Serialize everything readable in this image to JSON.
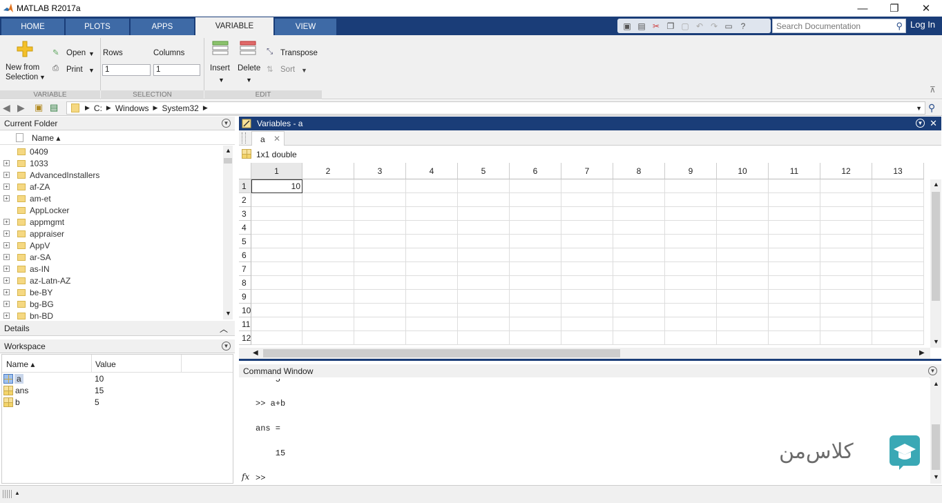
{
  "window": {
    "title": "MATLAB R2017a",
    "minimize": "—",
    "maximize": "❐",
    "close": "✕"
  },
  "tabs": [
    {
      "label": "HOME"
    },
    {
      "label": "PLOTS"
    },
    {
      "label": "APPS"
    },
    {
      "label": "VARIABLE"
    },
    {
      "label": "VIEW"
    }
  ],
  "search": {
    "placeholder": "Search Documentation"
  },
  "login": "Log In",
  "ribbon": {
    "new_from_selection_1": "New from",
    "new_from_selection_2": "Selection",
    "open": "Open",
    "print": "Print",
    "rows_label": "Rows",
    "columns_label": "Columns",
    "rows_value": "1",
    "columns_value": "1",
    "insert": "Insert",
    "delete": "Delete",
    "transpose": "Transpose",
    "sort": "Sort",
    "group_variable": "VARIABLE",
    "group_selection": "SELECTION",
    "group_edit": "EDIT"
  },
  "address": {
    "parts": [
      "C:",
      "Windows",
      "System32"
    ]
  },
  "current_folder": {
    "title": "Current Folder",
    "name_header": "Name ▴",
    "items": [
      {
        "name": "0409",
        "expandable": false
      },
      {
        "name": "1033",
        "expandable": true
      },
      {
        "name": "AdvancedInstallers",
        "expandable": true
      },
      {
        "name": "af-ZA",
        "expandable": true
      },
      {
        "name": "am-et",
        "expandable": true
      },
      {
        "name": "AppLocker",
        "expandable": false
      },
      {
        "name": "appmgmt",
        "expandable": true
      },
      {
        "name": "appraiser",
        "expandable": true
      },
      {
        "name": "AppV",
        "expandable": true
      },
      {
        "name": "ar-SA",
        "expandable": true
      },
      {
        "name": "as-IN",
        "expandable": true
      },
      {
        "name": "az-Latn-AZ",
        "expandable": true
      },
      {
        "name": "be-BY",
        "expandable": true
      },
      {
        "name": "bg-BG",
        "expandable": true
      },
      {
        "name": "bn-BD",
        "expandable": true
      }
    ]
  },
  "details": {
    "title": "Details"
  },
  "workspace": {
    "title": "Workspace",
    "col_name": "Name ▴",
    "col_value": "Value",
    "rows": [
      {
        "name": "a",
        "value": "10"
      },
      {
        "name": "ans",
        "value": "15"
      },
      {
        "name": "b",
        "value": "5"
      }
    ]
  },
  "variables": {
    "title": "Variables - a",
    "tab": "a",
    "info": "1x1 double",
    "columns": [
      "1",
      "2",
      "3",
      "4",
      "5",
      "6",
      "7",
      "8",
      "9",
      "10",
      "11",
      "12",
      "13"
    ],
    "rows": [
      "1",
      "2",
      "3",
      "4",
      "5",
      "6",
      "7",
      "8",
      "9",
      "10",
      "11",
      "12"
    ],
    "cell_1_1": "10"
  },
  "command_window": {
    "title": "Command Window",
    "lines": [
      ">> a+b",
      "ans =",
      "    15"
    ],
    "prompt": ">>",
    "fx": "fx"
  },
  "watermark": {
    "text": "کلاس‌من"
  }
}
